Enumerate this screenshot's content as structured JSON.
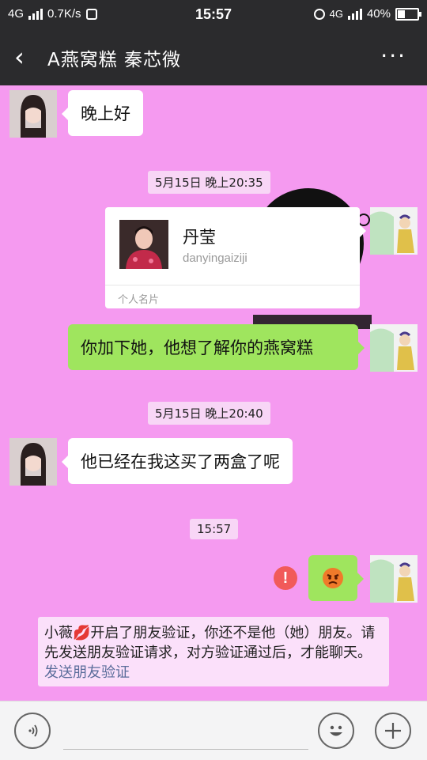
{
  "status": {
    "network": "4G",
    "speed": "0.7K/s",
    "time": "15:57",
    "network_right": "4G",
    "battery": "40%",
    "battery_level": 0.4
  },
  "header": {
    "back_glyph": "‹",
    "title": "A燕窝糕 秦芯微",
    "more_glyph": "···"
  },
  "messages": {
    "m1": "晚上好",
    "time1": "5月15日 晚上20:35",
    "card": {
      "name": "丹莹",
      "account": "danyingaiziji",
      "type": "个人名片"
    },
    "m2": "你加下她，他想了解你的燕窝糕",
    "time2": "5月15日 晚上20:40",
    "m3": "他已经在我这买了两盒了呢",
    "time3": "15:57",
    "m4_icon": "angry-face-emoji",
    "error_glyph": "!"
  },
  "notice": {
    "text": "小薇💋开启了朋友验证，你还不是他（她）朋友。请先发送朋友验证请求，对方验证通过后，才能聊天。",
    "link": "发送朋友验证"
  },
  "colors": {
    "chat_bg": "#f59af0",
    "green_bubble": "#9fe55e",
    "header_bg": "#2b2b2d",
    "error_red": "#f15a5a"
  }
}
